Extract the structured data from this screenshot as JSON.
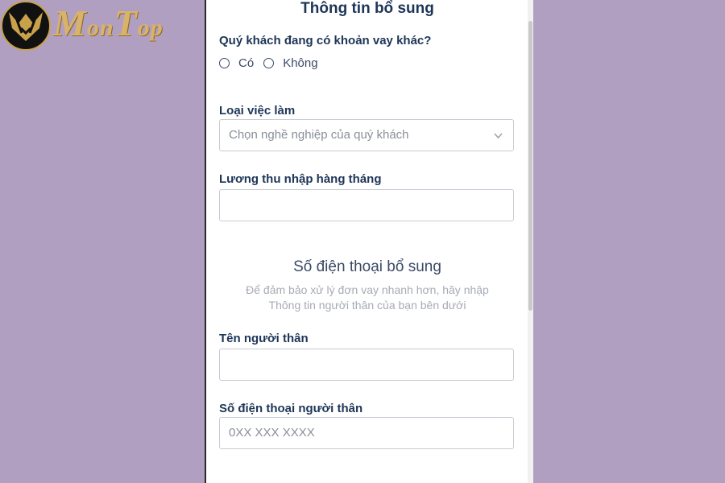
{
  "logo": {
    "text_first": "M",
    "text_rest": "on",
    "text_T": "T",
    "text_end": "op"
  },
  "form": {
    "title": "Thông tin bổ sung",
    "other_loan": {
      "question": "Quý khách đang có khoản vay khác?",
      "options": [
        "Có",
        "Không"
      ]
    },
    "job": {
      "label": "Loại việc làm",
      "placeholder": "Chọn nghề nghiệp của quý khách"
    },
    "income": {
      "label": "Lương thu nhập hàng tháng",
      "value": ""
    },
    "extra_phone": {
      "title": "Số điện thoại bổ sung",
      "subtitle_line1": "Để đảm bảo xử lý đơn vay nhanh hơn, hãy nhập",
      "subtitle_line2": "Thông tin người thân của bạn bên dưới"
    },
    "relative_name": {
      "label": "Tên người thân",
      "value": ""
    },
    "relative_phone": {
      "label": "Số điện thoại người thân",
      "placeholder": "0XX XXX XXXX"
    }
  },
  "colors": {
    "background": "#b19fc2",
    "heading": "#1d3557",
    "logo_gold": "#d9b36a"
  },
  "icons": {
    "select_arrow": "chevron-down-icon",
    "logo_emblem": "mask-emblem-icon"
  }
}
